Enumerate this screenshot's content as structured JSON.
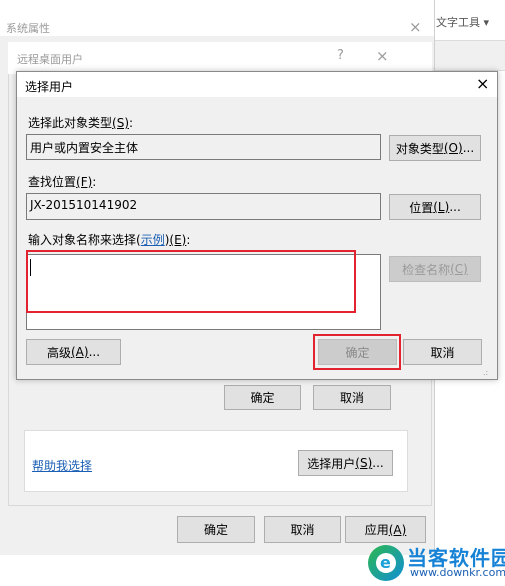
{
  "system_properties": {
    "title": "系统属性",
    "close_glyph": "×",
    "buttons": {
      "ok": "确定",
      "cancel": "取消",
      "apply": "应用",
      "apply_key": "(A)"
    }
  },
  "background_app": {
    "partial_text": "文字工具 ▾"
  },
  "remote_desktop_users": {
    "title": "远程桌面用户",
    "help_glyph": "?",
    "close_glyph": "×",
    "help_link": "帮助我选择",
    "select_users_button": {
      "text": "选择用户",
      "key": "(S)",
      "ellipsis": "..."
    },
    "ok": "确定",
    "cancel": "取消"
  },
  "select_users_dialog": {
    "title": "选择用户",
    "close_glyph": "×",
    "object_type": {
      "label": "选择此对象类型",
      "label_key": "(S)",
      "label_suffix": ":",
      "value": "用户或内置安全主体",
      "button": {
        "text": "对象类型",
        "key": "(O)",
        "ellipsis": "..."
      }
    },
    "location": {
      "label": "查找位置",
      "label_key": "(F)",
      "label_suffix": ":",
      "value": "JX-201510141902",
      "button": {
        "text": "位置",
        "key": "(L)",
        "ellipsis": "..."
      }
    },
    "names": {
      "label": "输入对象名称来选择",
      "link_open": "(",
      "link": "示例",
      "link_close": ")",
      "label_key": "(E)",
      "label_suffix": ":",
      "value": ""
    },
    "check_names_button": {
      "text": "检查名称",
      "key": "(C)"
    },
    "advanced_button": {
      "text": "高级",
      "key": "(A)",
      "ellipsis": "..."
    },
    "ok": "确定",
    "cancel": "取消",
    "grip_glyph": ".:"
  },
  "annotation_color": "#e0232e",
  "watermark": {
    "name": "当客软件园",
    "url": "www.downkr.com",
    "badge_letter": "e"
  }
}
